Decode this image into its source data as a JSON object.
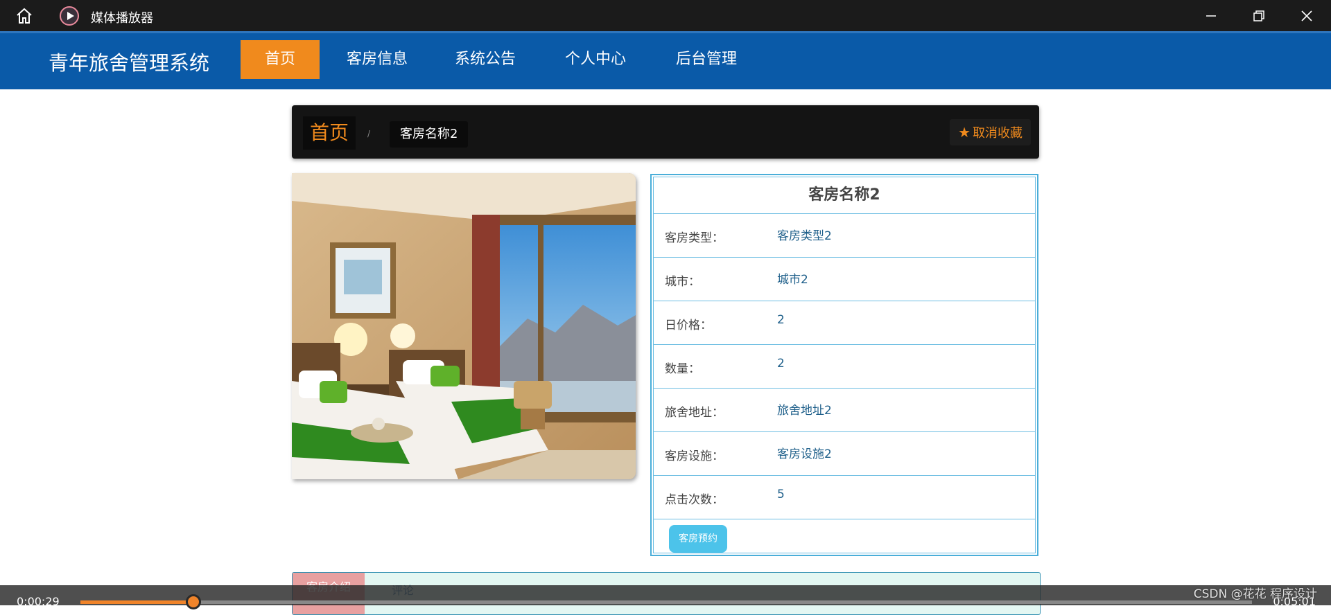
{
  "window": {
    "title": "媒体播放器",
    "icons": {
      "home": "home-icon",
      "app": "media-player-icon",
      "minimize": "minimize-icon",
      "maximize": "restore-icon",
      "close": "close-icon"
    }
  },
  "site": {
    "title": "青年旅舍管理系统",
    "nav": [
      {
        "label": "首页",
        "active": true
      },
      {
        "label": "客房信息",
        "active": false
      },
      {
        "label": "系统公告",
        "active": false
      },
      {
        "label": "个人中心",
        "active": false
      },
      {
        "label": "后台管理",
        "active": false
      }
    ],
    "colors": {
      "nav_bg": "#0a5aa8",
      "accent": "#f08a1d",
      "table_border": "#4aaed9",
      "book_button": "#4cc3ea"
    }
  },
  "breadcrumb": {
    "home": "首页",
    "separator": "/",
    "current": "客房名称2"
  },
  "favorite": {
    "icon": "star-icon",
    "label": "取消收藏"
  },
  "room": {
    "name": "客房名称2",
    "image_alt": "hotel-room-photo",
    "fields": [
      {
        "label": "客房类型：",
        "value": "客房类型2"
      },
      {
        "label": "城市：",
        "value": "城市2"
      },
      {
        "label": "日价格：",
        "value": "2"
      },
      {
        "label": "数量：",
        "value": "2"
      },
      {
        "label": "旅舍地址：",
        "value": "旅舍地址2"
      },
      {
        "label": "客房设施：",
        "value": "客房设施2"
      },
      {
        "label": "点击次数：",
        "value": "5"
      }
    ],
    "book_button": "客房预约"
  },
  "tabs": {
    "intro": "客房介绍",
    "comment": "评论"
  },
  "player": {
    "current_time": "0:00:29",
    "total_time": "0:05:01",
    "progress": 0.0963
  },
  "watermark": "CSDN @花花 程序设计"
}
